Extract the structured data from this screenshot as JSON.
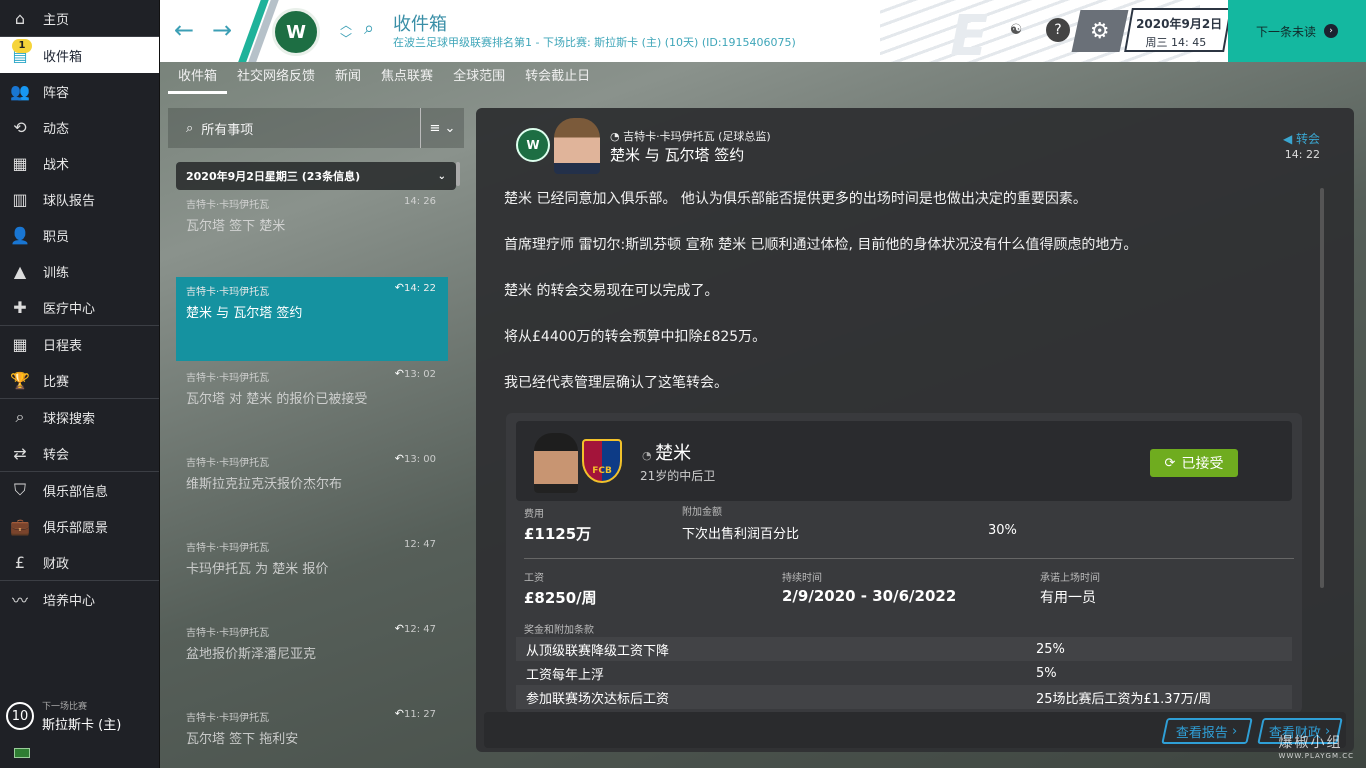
{
  "sidebar": {
    "inbox_badge": "1",
    "items": [
      {
        "label": "主页",
        "icon": "home-icon"
      },
      {
        "label": "收件箱",
        "icon": "inbox-icon"
      },
      {
        "label": "阵容",
        "icon": "squad-icon"
      },
      {
        "label": "动态",
        "icon": "dynamics-icon"
      },
      {
        "label": "战术",
        "icon": "tactics-icon"
      },
      {
        "label": "球队报告",
        "icon": "report-icon"
      },
      {
        "label": "职员",
        "icon": "staff-icon"
      },
      {
        "label": "训练",
        "icon": "training-icon"
      },
      {
        "label": "医疗中心",
        "icon": "medical-icon"
      },
      {
        "label": "日程表",
        "icon": "calendar-icon"
      },
      {
        "label": "比赛",
        "icon": "trophy-icon"
      },
      {
        "label": "球探搜索",
        "icon": "search-icon"
      },
      {
        "label": "转会",
        "icon": "transfer-icon"
      },
      {
        "label": "俱乐部信息",
        "icon": "shield-icon"
      },
      {
        "label": "俱乐部愿景",
        "icon": "briefcase-icon"
      },
      {
        "label": "财政",
        "icon": "finance-icon"
      },
      {
        "label": "培养中心",
        "icon": "development-icon"
      }
    ],
    "next_match_label": "下一场比赛",
    "next_match_days": "10",
    "next_match_team": "斯拉斯卡 (主)"
  },
  "header": {
    "title": "收件箱",
    "subtitle": "在波兰足球甲级联赛排名第1 - 下场比赛: 斯拉斯卡 (主) (10天) (ID:1915406075)",
    "date": "2020年9月2日",
    "time": "周三 14: 45",
    "continue_label": "下一条未读"
  },
  "tabs": [
    "收件箱",
    "社交网络反馈",
    "新闻",
    "焦点联赛",
    "全球范围",
    "转会截止日"
  ],
  "list": {
    "search_label": "所有事项",
    "group_label": "2020年9月2日星期三 (23条信息)",
    "messages": [
      {
        "sender": "吉特卡·卡玛伊托瓦",
        "subject": "瓦尔塔 签下 楚米",
        "time": "14: 26"
      },
      {
        "sender": "吉特卡·卡玛伊托瓦",
        "subject": "楚米 与 瓦尔塔 签约",
        "time": "14: 22"
      },
      {
        "sender": "吉特卡·卡玛伊托瓦",
        "subject": "瓦尔塔 对 楚米 的报价已被接受",
        "time": "13: 02"
      },
      {
        "sender": "吉特卡·卡玛伊托瓦",
        "subject": "维斯拉克拉克沃报价杰尔布",
        "time": "13: 00"
      },
      {
        "sender": "吉特卡·卡玛伊托瓦",
        "subject": "卡玛伊托瓦 为 楚米 报价",
        "time": "12: 47"
      },
      {
        "sender": "吉特卡·卡玛伊托瓦",
        "subject": "盆地报价斯泽潘尼亚克",
        "time": "12: 47"
      },
      {
        "sender": "吉特卡·卡玛伊托瓦",
        "subject": "瓦尔塔 签下 拖利安",
        "time": "11: 27"
      }
    ]
  },
  "message": {
    "from": "吉特卡·卡玛伊托瓦 (足球总监)",
    "subject": "楚米 与 瓦尔塔 签约",
    "tag": "转会",
    "time": "14: 22",
    "paragraphs": [
      "楚米 已经同意加入俱乐部。 他认为俱乐部能否提供更多的出场时间是也做出决定的重要因素。",
      "首席理疗师 雷切尔:斯凯芬顿 宣称 楚米 已顺利通过体检, 目前他的身体状况没有什么值得顾虑的地方。",
      "楚米 的转会交易现在可以完成了。",
      "将从£4400万的转会预算中扣除£825万。",
      "我已经代表管理层确认了这笔转会。"
    ],
    "deal": {
      "player_name": "楚米",
      "player_desc": "21岁的中后卫",
      "status": "已接受",
      "club_crest_text": "FCB",
      "fee_label": "费用",
      "fee": "£1125万",
      "extra_label": "附加金额",
      "extra_item": "下次出售利润百分比",
      "extra_value": "30%",
      "wage_label": "工资",
      "wage": "£8250/周",
      "duration_label": "持续时间",
      "duration": "2/9/2020 - 30/6/2022",
      "playing_time_label": "承诺上场时间",
      "playing_time": "有用一员",
      "bonus_label": "奖金和附加条款",
      "clauses": [
        {
          "name": "从顶级联赛降级工资下降",
          "value": "25%"
        },
        {
          "name": "工资每年上浮",
          "value": "5%"
        },
        {
          "name": "参加联赛场次达标后工资",
          "value": "25场比赛后工资为£1.37万/周"
        }
      ]
    },
    "footer_report": "查看报告",
    "footer_finance": "查看财政"
  },
  "watermark": {
    "main": "爆椒小组",
    "sub": "WWW.PLAYGM.CC"
  },
  "colors": {
    "accent": "#14b8a0",
    "selected": "#1592a0",
    "accepted": "#6fac1f",
    "link": "#2f9fd6"
  }
}
